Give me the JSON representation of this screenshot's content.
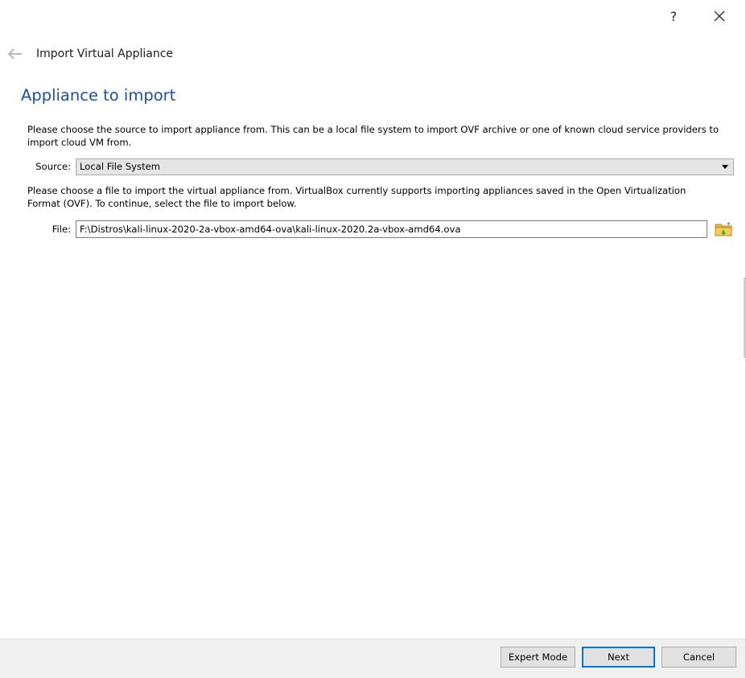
{
  "window": {
    "help_label": "?",
    "title": "Import Virtual Appliance"
  },
  "page": {
    "heading": "Appliance to import",
    "source_description": "Please choose the source to import appliance from. This can be a local file system to import OVF archive or one of known cloud service providers to import cloud VM from.",
    "file_description": "Please choose a file to import the virtual appliance from. VirtualBox currently supports importing appliances saved in the Open Virtualization Format (OVF). To continue, select the file to import below."
  },
  "source": {
    "label": "Source:",
    "selected": "Local File System"
  },
  "file": {
    "label": "File:",
    "value": "F:\\Distros\\kali-linux-2020-2a-vbox-amd64-ova\\kali-linux-2020.2a-vbox-amd64.ova"
  },
  "buttons": {
    "expert_mode": "Expert Mode",
    "next": "Next",
    "cancel": "Cancel"
  },
  "icons": {
    "help": "help-icon",
    "close": "close-icon",
    "back": "back-arrow-icon",
    "browse": "folder-icon",
    "dropdown": "chevron-down-icon"
  },
  "colors": {
    "heading": "#1e4fa5",
    "default_button_border": "#0078d7",
    "footer_bg": "#f0f0f0"
  }
}
